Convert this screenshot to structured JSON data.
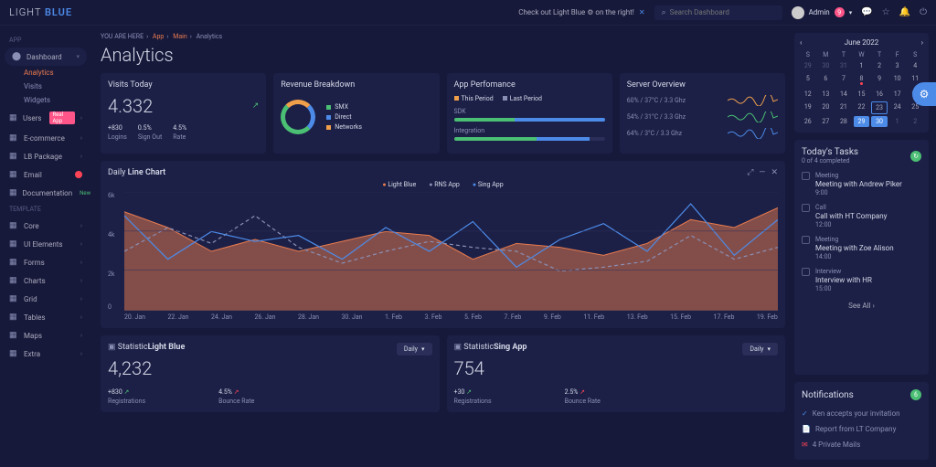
{
  "header": {
    "logo1": "LIGHT",
    "logo2": "BLUE",
    "banner": "Check out Light Blue ⚙ on the right!",
    "search_ph": "Search Dashboard",
    "user": "Admin",
    "user_badge": "9"
  },
  "sidebar": {
    "section_app": "APP",
    "dashboard": "Dashboard",
    "subs": [
      "Analytics",
      "Visits",
      "Widgets"
    ],
    "items": [
      {
        "label": "Users",
        "badge": "Real App"
      },
      {
        "label": "E-commerce"
      },
      {
        "label": "LB Package"
      },
      {
        "label": "Email",
        "red": true
      },
      {
        "label": "Documentation",
        "new": "New"
      }
    ],
    "section_tmpl": "TEMPLATE",
    "tmpl": [
      "Core",
      "UI Elements",
      "Forms",
      "Charts",
      "Grid",
      "Tables",
      "Maps",
      "Extra"
    ]
  },
  "crumb": {
    "pre": "YOU ARE HERE",
    "app": "App",
    "main": "Main",
    "cur": "Analytics"
  },
  "title": "Analytics",
  "visits": {
    "h": "Visits Today",
    "val": "4.332",
    "stats": [
      {
        "v": "+830",
        "l": "Logins"
      },
      {
        "v": "0.5%",
        "l": "Sign Out"
      },
      {
        "v": "4.5%",
        "l": "Rate"
      }
    ]
  },
  "revenue": {
    "h": "Revenue Breakdown",
    "leg": [
      {
        "c": "#4bbf73",
        "l": "SMX"
      },
      {
        "c": "#4d8be8",
        "l": "Direct"
      },
      {
        "c": "#f0a04b",
        "l": "Networks"
      }
    ]
  },
  "perf": {
    "h": "App Perfomance",
    "leg": [
      {
        "c": "#f0a04b",
        "l": "This Period"
      },
      {
        "c": "#8a8fb5",
        "l": "Last Period"
      }
    ],
    "rows": [
      {
        "l": "SDK",
        "a": 40,
        "b": 70
      },
      {
        "l": "Integration",
        "a": 55,
        "b": 35
      }
    ]
  },
  "server": {
    "h": "Server Overview",
    "rows": [
      {
        "l": "60% / 37°C / 3.3 Ghz",
        "c": "#f0a04b"
      },
      {
        "l": "54% / 31°C / 3.3 Ghz",
        "c": "#4bbf73"
      },
      {
        "l": "64% / 3°C / 3.3 Ghz",
        "c": "#4d8be8"
      }
    ]
  },
  "linechart": {
    "h1": "Daily ",
    "h2": "Line Chart",
    "leg": [
      {
        "c": "#e97b4e",
        "l": "Light Blue"
      },
      {
        "c": "#8a8fb5",
        "l": "RNS App"
      },
      {
        "c": "#4d8be8",
        "l": "Sing App"
      }
    ],
    "ylabs": [
      "6k",
      "4k",
      "2k",
      "0"
    ],
    "xlabs": [
      "20. Jan",
      "22. Jan",
      "24. Jan",
      "26. Jan",
      "28. Jan",
      "30. Jan",
      "1. Feb",
      "3. Feb",
      "5. Feb",
      "7. Feb",
      "9. Feb",
      "11. Feb",
      "13. Feb",
      "15. Feb",
      "17. Feb",
      "19. Feb"
    ]
  },
  "stat1": {
    "h1": "Statistic",
    "h2": "Light Blue",
    "val": "4,232",
    "a": {
      "v": "+830",
      "l": "Registrations"
    },
    "b": {
      "v": "4.5%",
      "l": "Bounce Rate"
    },
    "drop": "Daily"
  },
  "stat2": {
    "h1": "Statistic",
    "h2": "Sing App",
    "val": "754",
    "a": {
      "v": "+30",
      "l": "Registrations"
    },
    "b": {
      "v": "2.5%",
      "l": "Bounce Rate"
    },
    "drop": "Daily"
  },
  "cal": {
    "month": "June 2022",
    "dh": [
      "S",
      "M",
      "T",
      "W",
      "T",
      "F",
      "S"
    ],
    "days": [
      {
        "d": 29,
        "om": 1
      },
      {
        "d": 30,
        "om": 1
      },
      {
        "d": 31,
        "om": 1
      },
      {
        "d": 1
      },
      {
        "d": 2
      },
      {
        "d": 3
      },
      {
        "d": 4
      },
      {
        "d": 5
      },
      {
        "d": 6
      },
      {
        "d": 7
      },
      {
        "d": 8,
        "dot": 1
      },
      {
        "d": 9
      },
      {
        "d": 10
      },
      {
        "d": 11
      },
      {
        "d": 12
      },
      {
        "d": 13
      },
      {
        "d": 14
      },
      {
        "d": 15
      },
      {
        "d": 16
      },
      {
        "d": 17
      },
      {
        "d": 18
      },
      {
        "d": 19
      },
      {
        "d": 20
      },
      {
        "d": 21
      },
      {
        "d": 22
      },
      {
        "d": 23,
        "today": 1
      },
      {
        "d": 24
      },
      {
        "d": 25
      },
      {
        "d": 26
      },
      {
        "d": 27
      },
      {
        "d": 28
      },
      {
        "d": 29,
        "sel": 1
      },
      {
        "d": 30,
        "sel": 1
      },
      {
        "d": 1,
        "om": 1
      },
      {
        "d": 2,
        "om": 1
      }
    ]
  },
  "tasks": {
    "h": "Today's Tasks",
    "sub": "0 of 4 completed",
    "items": [
      {
        "t": "Meeting",
        "n": "Meeting with Andrew Piker",
        "m": "9:00"
      },
      {
        "t": "Call",
        "n": "Call with HT Company",
        "m": "12:00"
      },
      {
        "t": "Meeting",
        "n": "Meeting with Zoe Alison",
        "m": "14:00"
      },
      {
        "t": "Interview",
        "n": "Interview with HR",
        "m": "15:00"
      }
    ],
    "see": "See All"
  },
  "notif": {
    "h": "Notifications",
    "badge": "6",
    "items": [
      {
        "ic": "✓",
        "c": "#4d8be8",
        "t": "Ken accepts your invitation"
      },
      {
        "ic": "📄",
        "c": "#8a8fb5",
        "t": "Report from LT Company"
      },
      {
        "ic": "✉",
        "c": "#f45",
        "t": "4 Private Mails"
      }
    ]
  },
  "chart_data": {
    "type": "line",
    "x": [
      "20. Jan",
      "22. Jan",
      "24. Jan",
      "26. Jan",
      "28. Jan",
      "30. Jan",
      "1. Feb",
      "3. Feb",
      "5. Feb",
      "7. Feb",
      "9. Feb",
      "11. Feb",
      "13. Feb",
      "15. Feb",
      "17. Feb",
      "19. Feb"
    ],
    "series": [
      {
        "name": "Light Blue",
        "values": [
          5.0,
          4.2,
          3.0,
          3.6,
          3.0,
          3.5,
          4.0,
          3.8,
          2.6,
          3.4,
          3.2,
          2.8,
          3.4,
          4.6,
          4.2,
          5.2
        ]
      },
      {
        "name": "RNS App",
        "values": [
          3.0,
          4.2,
          3.4,
          4.8,
          3.2,
          2.4,
          3.0,
          3.5,
          3.2,
          3.0,
          2.0,
          2.2,
          2.5,
          3.8,
          2.6,
          3.2
        ]
      },
      {
        "name": "Sing App",
        "values": [
          4.8,
          2.6,
          4.0,
          3.5,
          3.8,
          2.6,
          4.2,
          3.0,
          4.5,
          2.2,
          3.6,
          4.4,
          3.0,
          5.4,
          2.8,
          4.6
        ]
      }
    ],
    "ylim": [
      0,
      6
    ],
    "ylabel": "k"
  }
}
